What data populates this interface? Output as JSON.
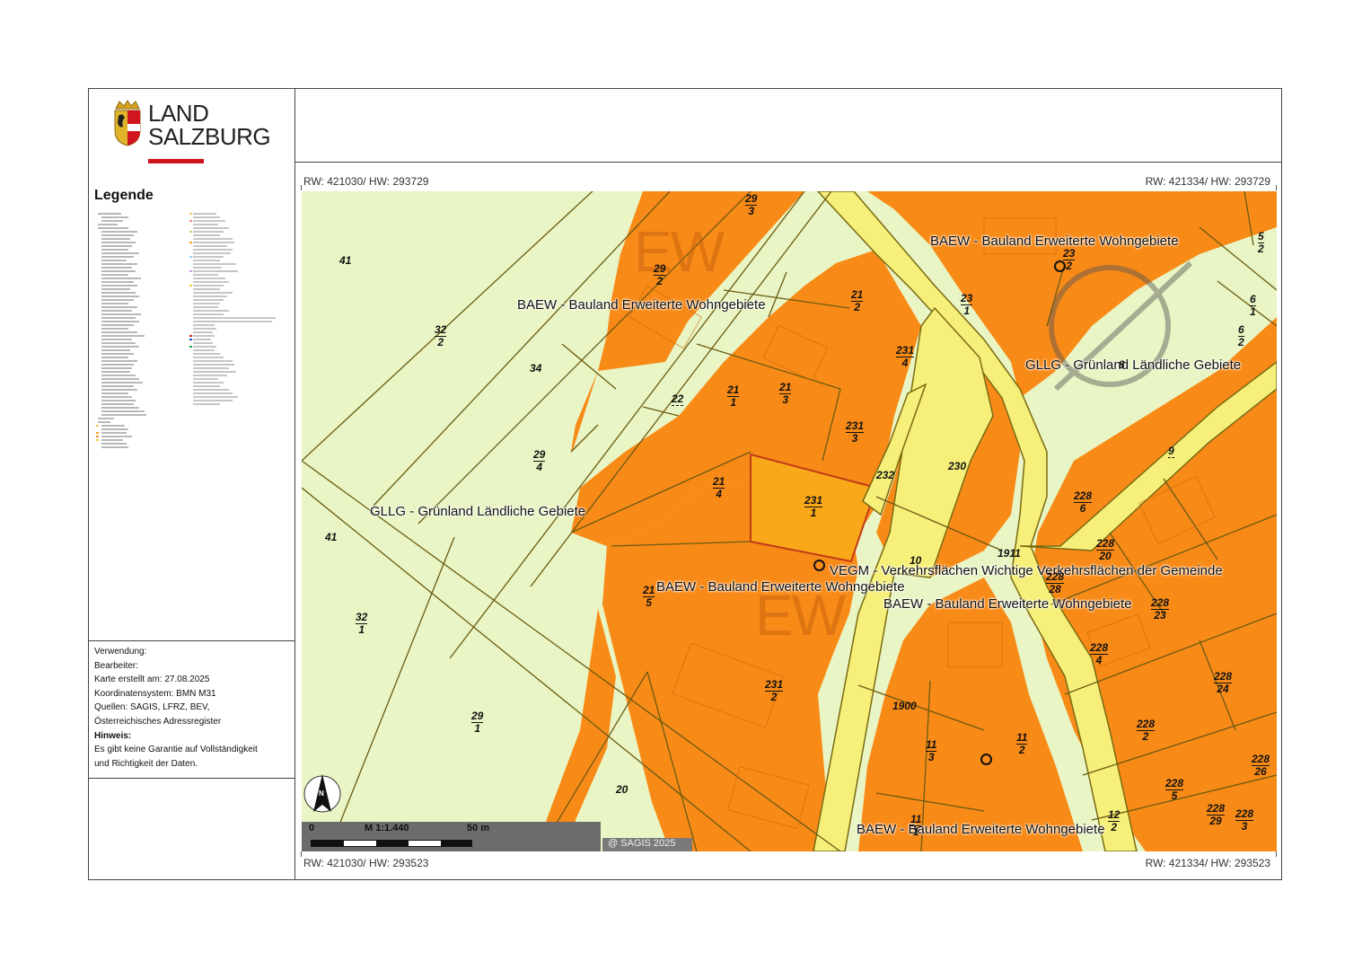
{
  "logo": {
    "line1": "LAND",
    "line2": "SALZBURG"
  },
  "legend": {
    "title": "Legende"
  },
  "info": {
    "usage": "Verwendung:",
    "editor": "Bearbeiter:",
    "created": "Karte erstellt am: 27.08.2025",
    "crs": "Koordinatensystem: BMN M31",
    "sources1": "Quellen: SAGIS, LFRZ, BEV,",
    "sources2": "Österreichisches Adressregister",
    "hint_title": "Hinweis:",
    "hint1": "Es gibt keine Garantie auf Vollständigkeit",
    "hint2": "und Richtigkeit der Daten."
  },
  "coords": {
    "top_left": "RW: 421030/ HW: 293729",
    "top_right": "RW: 421334/ HW: 293729",
    "bottom_left": "RW: 421030/ HW: 293523",
    "bottom_right": "RW: 421334/ HW: 293523"
  },
  "scale": {
    "zero": "0",
    "ratio": "M 1:1.440",
    "distance": "50 m"
  },
  "north": "N",
  "copyright": "@ SAGIS 2025",
  "colors": {
    "grassland": "#e9f5c4",
    "building_land": "#f88a17",
    "traffic": "#f6f07a",
    "highlight": "#f9a81a",
    "parcel_line": "#6b5a12"
  },
  "zones": {
    "baew": "BAEW - Bauland Erweiterte Wohngebiete",
    "gllg": "GLLG - Grünland Ländliche Gebiete",
    "vegm": "VEGM - Verkehrsflächen Wichtige Verkehrsflächen der Gemeinde",
    "ew": "EW"
  },
  "parcels": {
    "p41": "41",
    "p32_2n": "32",
    "p32_2d": "2",
    "p34": "34",
    "p29_4n": "29",
    "p29_4d": "4",
    "p29_3n": "29",
    "p29_3d": "3",
    "p29_2n": "29",
    "p29_2d": "2",
    "p22": "22",
    "p21_1n": "21",
    "p21_1d": "1",
    "p21_2n": "21",
    "p21_2d": "2",
    "p21_3n": "21",
    "p21_3d": "3",
    "p21_4n": "21",
    "p21_4d": "4",
    "p21_5n": "21",
    "p21_5d": "5",
    "p231_1n": "231",
    "p231_1d": "1",
    "p231_2n": "231",
    "p231_2d": "2",
    "p231_3n": "231",
    "p231_3d": "3",
    "p231_4n": "231",
    "p231_4d": "4",
    "p232": "232",
    "p230": "230",
    "p10": "10",
    "p1911": "1911",
    "p23_1n": "23",
    "p23_1d": "1",
    "p23_2n": "23",
    "p23_2d": "2",
    "p5_2n": "5",
    "p5_2d": "2",
    "p6_1n": "6",
    "p6_1d": "1",
    "p6_2n": "6",
    "p6_2d": "2",
    "p8": "8",
    "p9": "9",
    "p228_6n": "228",
    "p228_6d": "6",
    "p228_20n": "228",
    "p228_20d": "20",
    "p228_28n": "228",
    "p228_28d": "28",
    "p228_23n": "228",
    "p228_23d": "23",
    "p228_4n": "228",
    "p228_4d": "4",
    "p228_24n": "228",
    "p228_24d": "24",
    "p228_2n": "228",
    "p228_2d": "2",
    "p228_26n": "228",
    "p228_26d": "26",
    "p228_5n": "228",
    "p228_5d": "5",
    "p228_29n": "228",
    "p228_29d": "29",
    "p228_3n": "228",
    "p228_3d": "3",
    "p32_1n": "32",
    "p32_1d": "1",
    "p29_1n": "29",
    "p29_1d": "1",
    "p20": "20",
    "p1900": "1900",
    "p11_3n": "11",
    "p11_3d": "3",
    "p11_2n": "11",
    "p11_2d": "2",
    "p11_1n": "11",
    "p11_1d": "1",
    "p12_2n": "12",
    "p12_2d": "2",
    "p41b": "41"
  }
}
